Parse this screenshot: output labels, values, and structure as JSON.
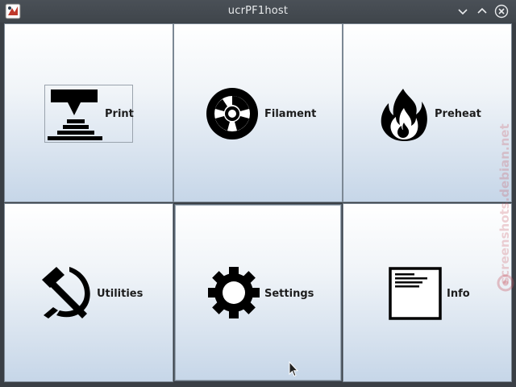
{
  "window": {
    "title": "ucrPF1host",
    "buttons": [
      "minimize",
      "maximize",
      "close"
    ]
  },
  "tiles": [
    {
      "label": "Print",
      "icon": "printer-icon"
    },
    {
      "label": "Filament",
      "icon": "filament-spool-icon"
    },
    {
      "label": "Preheat",
      "icon": "flame-icon"
    },
    {
      "label": "Utilities",
      "icon": "hammer-sickle-icon"
    },
    {
      "label": "Settings",
      "icon": "gear-icon"
    },
    {
      "label": "Info",
      "icon": "document-icon"
    }
  ],
  "watermark": "screenshots.debian.net",
  "colors": {
    "titlebar": "#43494f",
    "tile_top": "#ffffff",
    "tile_bottom": "#c6d6e8",
    "tile_border": "#7c8894"
  }
}
